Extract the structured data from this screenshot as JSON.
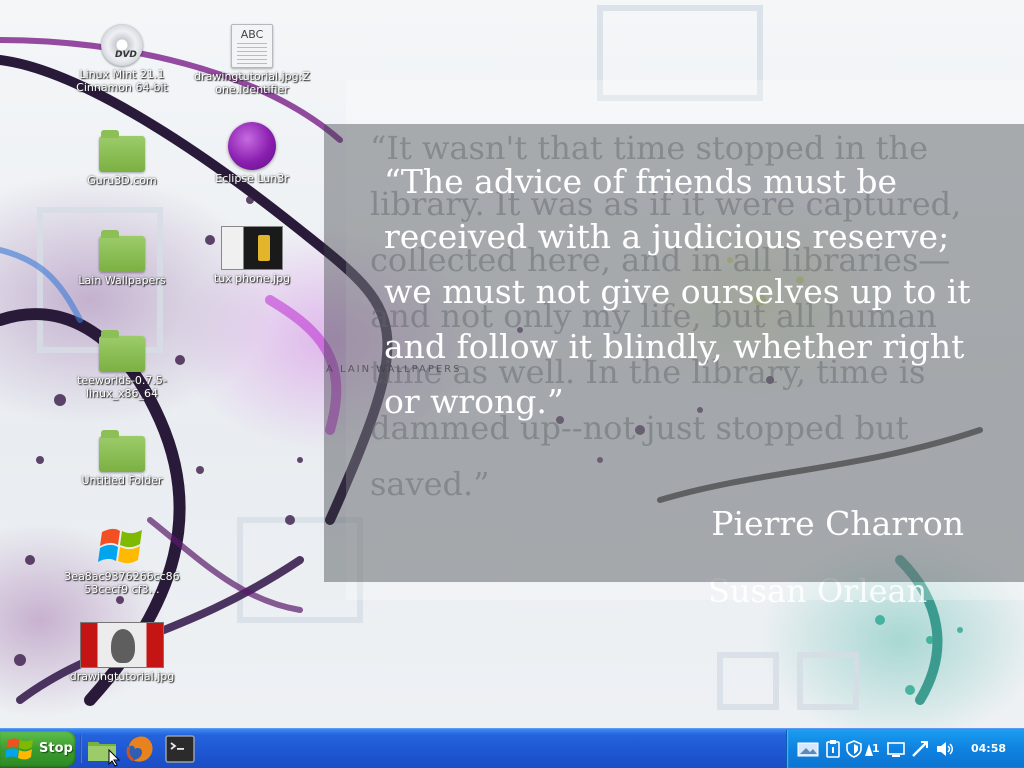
{
  "desktop": {
    "icons": [
      {
        "label": "Linux Mint 21.1 Cinnamon 64-bit",
        "icon": "dvd-icon"
      },
      {
        "label": "drawingtutorial.jpg:Zone.Identifier",
        "icon": "text-file-icon",
        "thumb_text": "ABC"
      },
      {
        "label": "Guru3D.com",
        "icon": "folder-icon"
      },
      {
        "label": "Eclipse Lun3r",
        "icon": "eclipse-icon"
      },
      {
        "label": "Lain Wallpapers",
        "icon": "folder-icon"
      },
      {
        "label": "tux phone.jpg",
        "icon": "image-icon"
      },
      {
        "label": "teeworlds-0.7.5-linux_x86_64",
        "icon": "folder-icon"
      },
      {
        "label": "Untitled Folder",
        "icon": "folder-icon"
      },
      {
        "label": "3ea8ac9376266cc8653cecf9 cf3…",
        "icon": "windows-installer-icon"
      },
      {
        "label": "drawingtutorial.jpg",
        "icon": "image-icon"
      }
    ],
    "dvd_text": "DVD"
  },
  "wallpaper": {
    "back_quote": "“It wasn't that time stopped in the library. It was as if it were captured, collected here, and in all libraries—and not only my life, but all human time as well. In the library, time is dammed up--not just stopped but saved.”",
    "back_author": "Susan Orlean",
    "front_quote": "“The advice of friends must be received with a judicious reserve; we must not give ourselves up to it and follow it blindly, whether right or wrong.”",
    "front_author": "Pierre Charron",
    "watermark": "A LAIN WALLPAPERS"
  },
  "taskbar": {
    "start_label": "Stop",
    "quick_launch": [
      {
        "name": "file-manager-icon"
      },
      {
        "name": "firefox-icon"
      },
      {
        "name": "terminal-icon"
      }
    ],
    "tray": {
      "notification_count": "1",
      "clock": "04:58"
    }
  },
  "colors": {
    "taskbar_blue": "#1f56d2",
    "start_green": "#3a9d2e",
    "tray_blue": "#0f82e0",
    "folder_green": "#7bb042"
  }
}
